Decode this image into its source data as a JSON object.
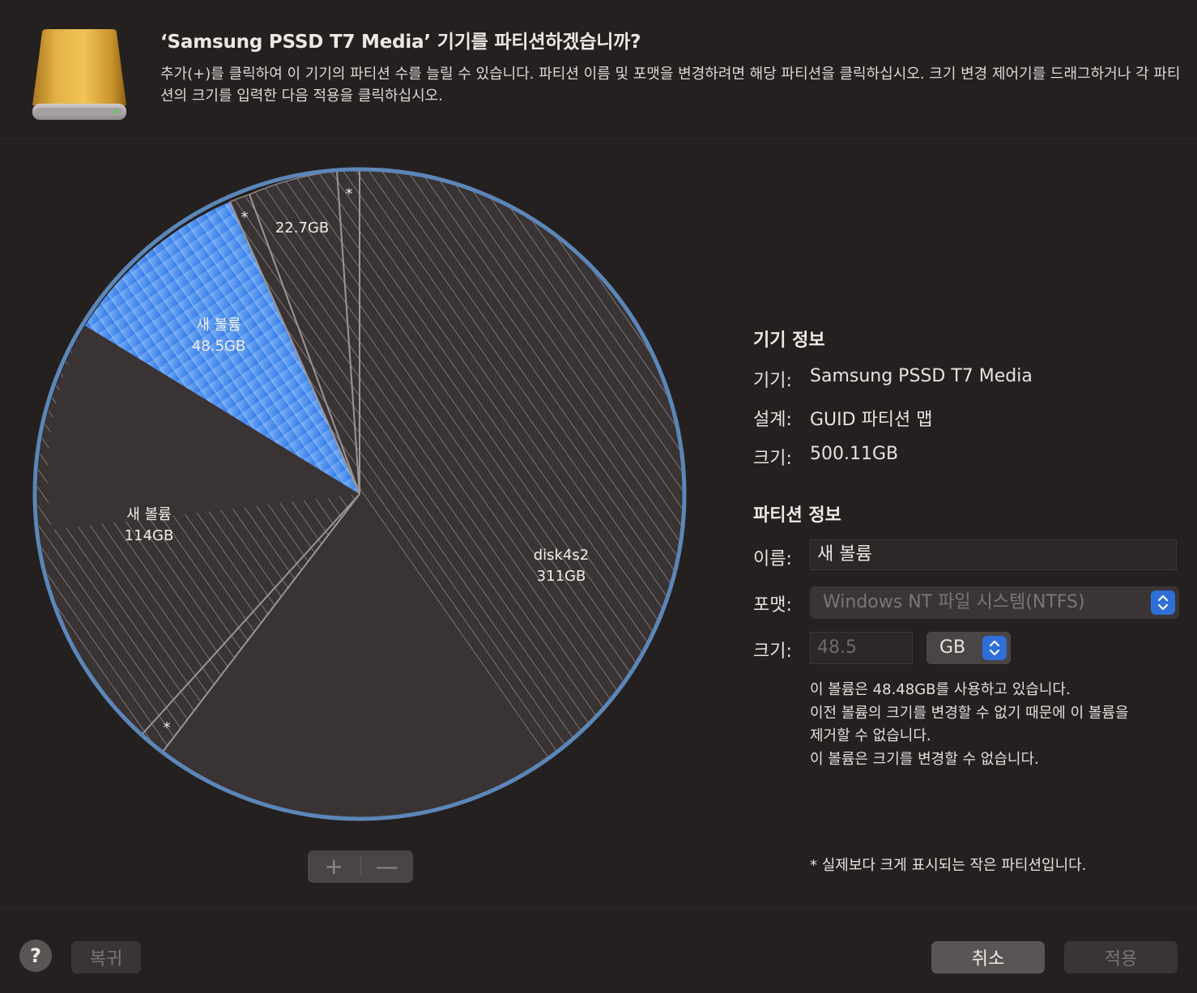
{
  "dialog": {
    "title": "‘Samsung PSSD T7 Media’ 기기를 파티션하겠습니까?",
    "description": "추가(+)를 클릭하여 이 기기의 파티션 수를 늘릴 수 있습니다. 파티션 이름 및 포맷을 변경하려면 해당 파티션을 클릭하십시오. 크기 변경 제어기를 드래그하거나 각 파티션의 크기를 입력한 다음 적용을 클릭하십시오."
  },
  "pie": {
    "segments": [
      {
        "name": "disk4s2",
        "size": "311GB",
        "selected": false
      },
      {
        "name": "",
        "size": "",
        "marker": "*",
        "selected": false
      },
      {
        "name": "새 볼륨",
        "size": "114GB",
        "selected": false
      },
      {
        "name": "새 볼륨",
        "size": "48.5GB",
        "selected": true
      },
      {
        "name": "",
        "size": "",
        "marker": "*",
        "selected": false
      },
      {
        "name": "",
        "size": "22.7GB",
        "selected": false
      },
      {
        "name": "",
        "size": "",
        "marker": "*",
        "selected": false
      }
    ],
    "colors": {
      "selected": "#3d86ee",
      "unselected": "#3a3333",
      "hatch": "#8a8585",
      "rim": "#5b87b8"
    }
  },
  "controls": {
    "add_label": "+",
    "remove_label": "—"
  },
  "device_info": {
    "heading": "기기 정보",
    "device_label": "기기:",
    "device_value": "Samsung PSSD T7 Media",
    "scheme_label": "설계:",
    "scheme_value": "GUID 파티션 맵",
    "size_label": "크기:",
    "size_value": "500.11GB"
  },
  "partition_info": {
    "heading": "파티션 정보",
    "name_label": "이름:",
    "name_value": "새 볼륨",
    "format_label": "포맷:",
    "format_value": "Windows NT 파일 시스템(NTFS)",
    "size_label": "크기:",
    "size_value": "48.5",
    "unit_value": "GB",
    "note_line1": "이 볼륨은 48.48GB를 사용하고 있습니다.",
    "note_line2": "이전 볼륨의 크기를 변경할 수 없기 때문에 이 볼륨을",
    "note_line3": "제거할 수 없습니다.",
    "note_line4": "이 볼륨은 크기를 변경할 수 없습니다."
  },
  "footnote": "* 실제보다 크게 표시되는 작은 파티션입니다.",
  "buttons": {
    "help": "?",
    "revert": "복귀",
    "cancel": "취소",
    "apply": "적용"
  },
  "icons": {
    "drive": "external-drive-icon",
    "stepper": "up-down-chevron-icon"
  }
}
